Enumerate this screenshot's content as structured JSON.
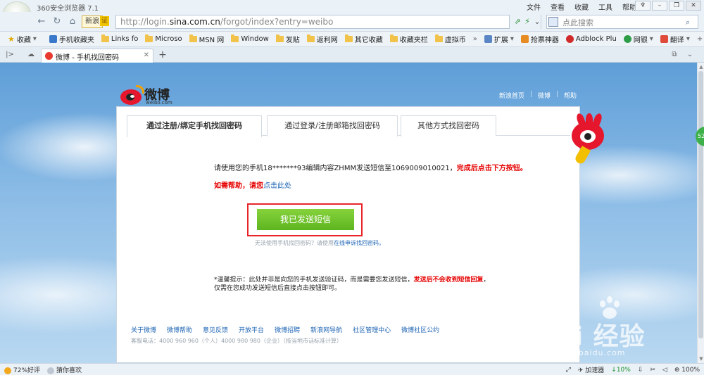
{
  "browser": {
    "app_title": "360安全浏览器 7.1",
    "menu": [
      "文件",
      "查看",
      "收藏",
      "工具",
      "帮助"
    ],
    "window_controls": [
      "pin-icon",
      "minimize-icon",
      "maximize-icon",
      "close-icon"
    ],
    "nav": {
      "sina_badge": "新浪",
      "cert_badge": "证",
      "url_prefix": "http://login.",
      "url_domain": "sina.com.cn",
      "url_path": "/forgot/index?entry=weibo",
      "search_placeholder": "点此搜索"
    },
    "bookmarks": [
      {
        "label": "收藏",
        "icon": "star-icon"
      },
      {
        "label": "手机收藏夹",
        "icon": "phone-icon"
      },
      {
        "label": "Links fo",
        "icon": "folder-icon"
      },
      {
        "label": "Microso",
        "icon": "folder-icon"
      },
      {
        "label": "MSN 网",
        "icon": "folder-icon"
      },
      {
        "label": "Window",
        "icon": "folder-icon"
      },
      {
        "label": "发贴",
        "icon": "folder-icon"
      },
      {
        "label": "返利网",
        "icon": "folder-icon"
      },
      {
        "label": "其它收藏",
        "icon": "folder-icon"
      },
      {
        "label": "收藏夹栏",
        "icon": "folder-icon"
      },
      {
        "label": "虚拟币",
        "icon": "folder-icon"
      }
    ],
    "bookmarks_overflow": "»",
    "extensions": [
      {
        "label": "扩展",
        "icon": "grid-icon"
      },
      {
        "label": "抢票神器",
        "icon": "ticket-icon"
      },
      {
        "label": "Adblock Plu",
        "icon": "adblock-icon"
      },
      {
        "label": "网银",
        "icon": "bank-icon"
      },
      {
        "label": "翻译",
        "icon": "translate-icon"
      },
      {
        "label": "更多",
        "icon": "plus-icon"
      }
    ],
    "tab": {
      "title": "微博 - 手机找回密码"
    },
    "statusbar": {
      "rating": "72%好评",
      "guess": "猜你喜欢",
      "accelerator": "加速器",
      "cpu": "10%",
      "zoom": "100%"
    }
  },
  "page": {
    "logo_text": "微博",
    "logo_sub": "weibo.com",
    "top_links": [
      "新浪首页",
      "微博",
      "帮助"
    ],
    "tabs": [
      {
        "label": "通过注册/绑定手机找回密码",
        "active": true
      },
      {
        "label": "通过登录/注册邮箱找回密码",
        "active": false
      },
      {
        "label": "其他方式找回密码",
        "active": false
      }
    ],
    "instruction_prefix": "请使用您的手机18*******93编辑内容ZHMM发送短信至1069009010021，",
    "instruction_red": "完成后点击下方按钮。",
    "help_red": "如需帮助，请您",
    "help_link": "点击此处",
    "send_button": "我已发送短信",
    "alt_hint_prefix": "无法使用手机找回密码？请使用",
    "alt_hint_link": "在线申诉找回密码。",
    "notice_line1_prefix": "*温馨提示：此处并非是向您的手机发送验证码，而是需要您发送短信，",
    "notice_line1_red": "发送后不会收到短信回复",
    "notice_line1_end": "，",
    "notice_line2": "仅需在您成功发送短信后直接点击按钮即可。",
    "footer_links": [
      "关于微博",
      "微博帮助",
      "意见反馈",
      "开放平台",
      "微博招聘",
      "新浪网导航",
      "社区管理中心",
      "微博社区公约"
    ],
    "footer_small": "客服电话：4000 960 960（个人）4000 980 980（企业）（按当地市话标准计算）"
  },
  "watermark": {
    "text": "Bai 经验",
    "url": "jingyan.baidu.com"
  },
  "side_float": "52",
  "colors": {
    "accent_red": "#e60000",
    "button_green": "#6cc22a",
    "link_blue": "#1d64b4",
    "weibo_red": "#e6162d"
  }
}
